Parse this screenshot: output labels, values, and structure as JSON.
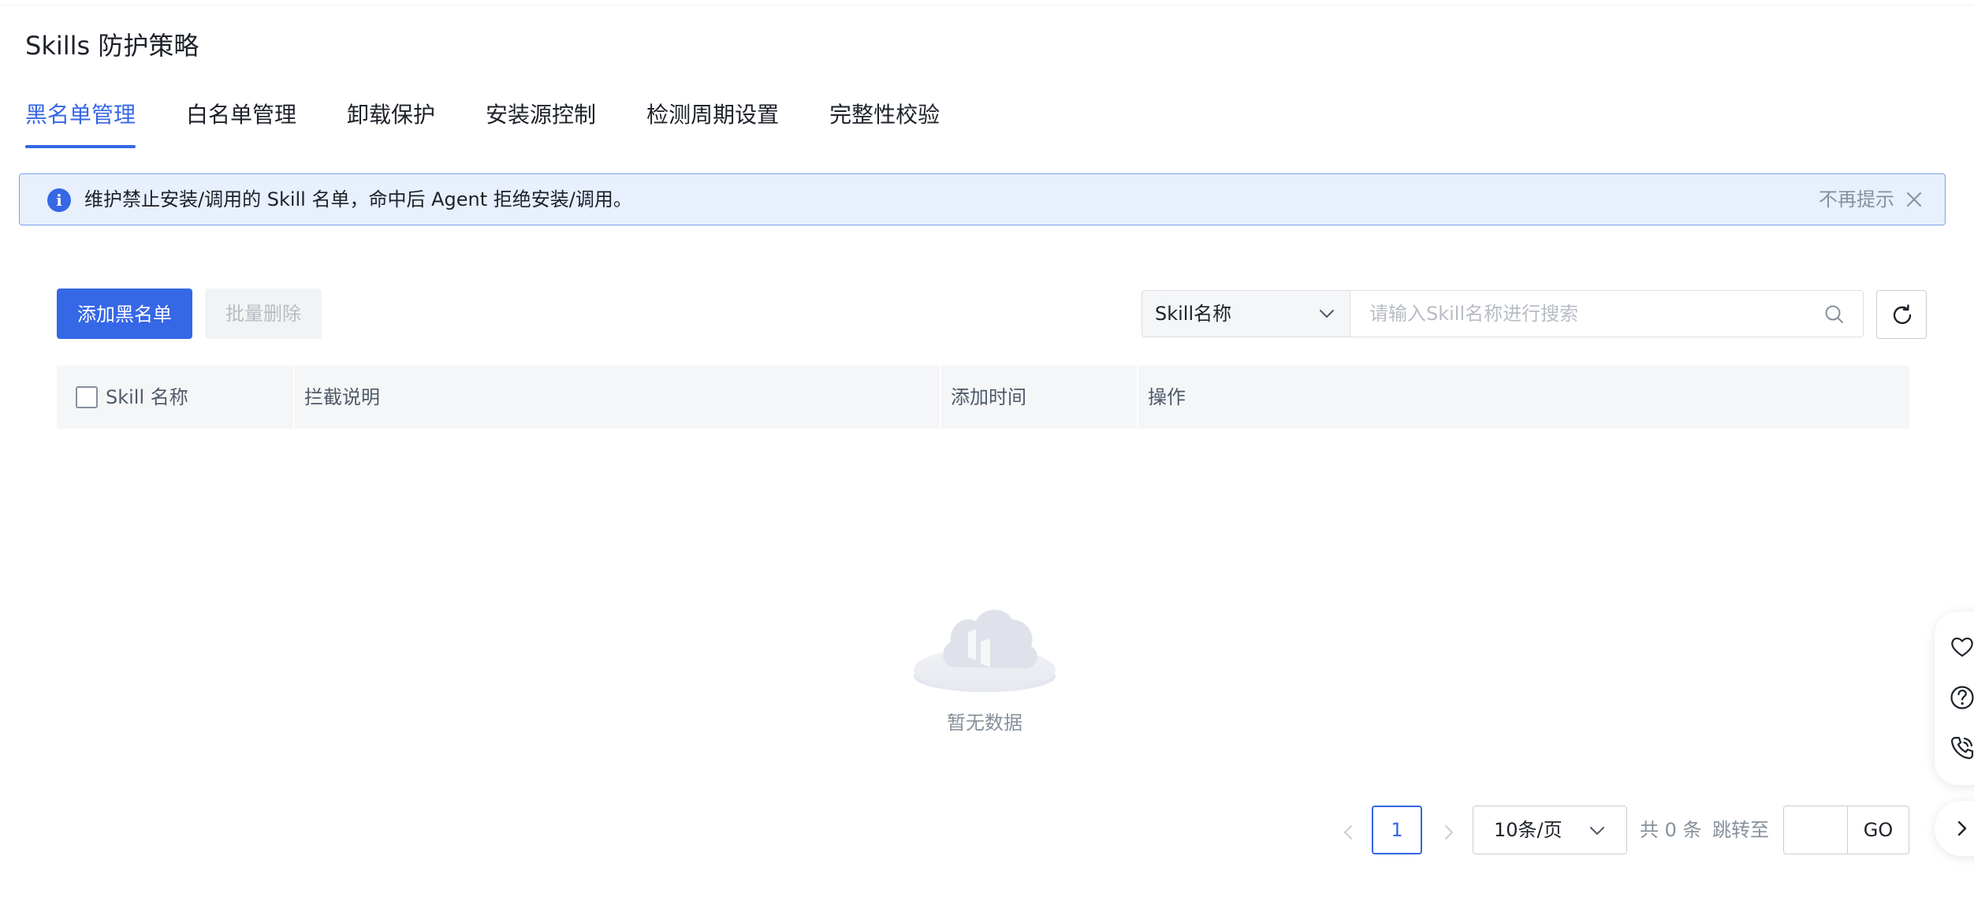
{
  "page": {
    "title": "Skills 防护策略"
  },
  "tabs": [
    {
      "label": "黑名单管理",
      "active": true
    },
    {
      "label": "白名单管理",
      "active": false
    },
    {
      "label": "卸载保护",
      "active": false
    },
    {
      "label": "安装源控制",
      "active": false
    },
    {
      "label": "检测周期设置",
      "active": false
    },
    {
      "label": "完整性校验",
      "active": false
    }
  ],
  "alert": {
    "icon": "info-icon",
    "icon_glyph": "i",
    "message": "维护禁止安装/调用的 Skill 名单，命中后 Agent 拒绝安装/调用。",
    "dismiss_label": "不再提示",
    "close_icon": "close-icon"
  },
  "toolbar": {
    "add_label": "添加黑名单",
    "batch_delete_label": "批量删除",
    "search_field_selected": "Skill名称",
    "search_placeholder": "请输入Skill名称进行搜索",
    "search_value": "",
    "refresh_icon": "refresh-icon"
  },
  "table": {
    "columns": [
      "Skill 名称",
      "拦截说明",
      "添加时间",
      "操作"
    ],
    "rows": [],
    "empty_text": "暂无数据"
  },
  "pagination": {
    "current_page": "1",
    "page_size_label": "10条/页",
    "total_label": "共 0 条",
    "jump_label": "跳转至",
    "jump_value": "",
    "go_label": "GO"
  },
  "side_tools": [
    "favorite-icon",
    "help-icon",
    "phone-icon",
    "chevron-right-icon"
  ],
  "colors": {
    "primary": "#3567e6",
    "alert_background": "#e8f0fd",
    "alert_border": "#7da2f0",
    "table_header_background": "#f5f6f8",
    "muted_text": "#86909c"
  }
}
